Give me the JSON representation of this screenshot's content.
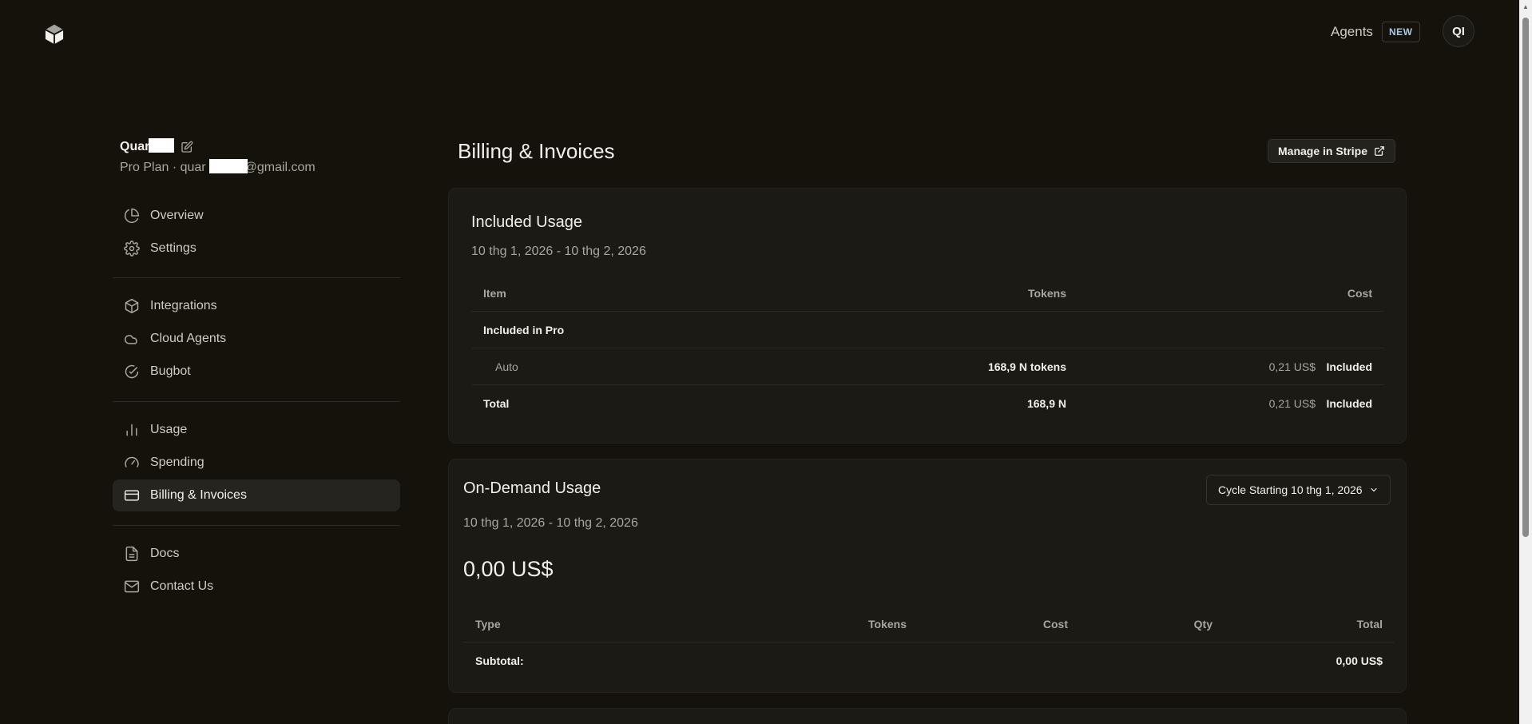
{
  "header": {
    "logo_icon": "cursor-cube-logo",
    "agents_label": "Agents",
    "new_badge": "NEW",
    "avatar_initials": "QI"
  },
  "sidebar": {
    "user_name": "Quar",
    "plan_line": "Pro Plan · quar",
    "email_suffix": "@gmail.com",
    "groups": [
      [
        {
          "label": "Overview",
          "icon": "pie-chart-icon"
        },
        {
          "label": "Settings",
          "icon": "gear-icon"
        }
      ],
      [
        {
          "label": "Integrations",
          "icon": "cube-icon"
        },
        {
          "label": "Cloud Agents",
          "icon": "cloud-icon"
        },
        {
          "label": "Bugbot",
          "icon": "check-circle-icon"
        }
      ],
      [
        {
          "label": "Usage",
          "icon": "bar-chart-icon"
        },
        {
          "label": "Spending",
          "icon": "gauge-icon"
        },
        {
          "label": "Billing & Invoices",
          "icon": "credit-card-icon",
          "active": true
        }
      ],
      [
        {
          "label": "Docs",
          "icon": "document-icon"
        },
        {
          "label": "Contact Us",
          "icon": "mail-icon"
        }
      ]
    ]
  },
  "main": {
    "title": "Billing & Invoices",
    "manage_stripe_label": "Manage in Stripe",
    "included_usage": {
      "title": "Included Usage",
      "date_range": "10 thg 1, 2026 - 10 thg 2, 2026",
      "headers": {
        "item": "Item",
        "tokens": "Tokens",
        "cost": "Cost"
      },
      "group_label": "Included in Pro",
      "rows": [
        {
          "item": "Auto",
          "tokens": "168,9 N tokens",
          "cost": "0,21 US$",
          "status": "Included"
        }
      ],
      "total": {
        "item": "Total",
        "tokens": "168,9 N",
        "cost": "0,21 US$",
        "status": "Included"
      }
    },
    "on_demand": {
      "title": "On-Demand Usage",
      "cycle_label": "Cycle Starting 10 thg 1, 2026",
      "date_range": "10 thg 1, 2026 - 10 thg 2, 2026",
      "amount": "0,00 US$",
      "headers": {
        "type": "Type",
        "tokens": "Tokens",
        "cost": "Cost",
        "qty": "Qty",
        "total": "Total"
      },
      "subtotal_label": "Subtotal:",
      "subtotal_value": "0,00 US$"
    }
  },
  "colors": {
    "background": "#14120b",
    "card": "#1b1a15",
    "active_nav": "#26241e",
    "text_primary": "#f2f0ea",
    "text_muted": "#a9a69d",
    "badge_text": "#a9c7e8"
  }
}
